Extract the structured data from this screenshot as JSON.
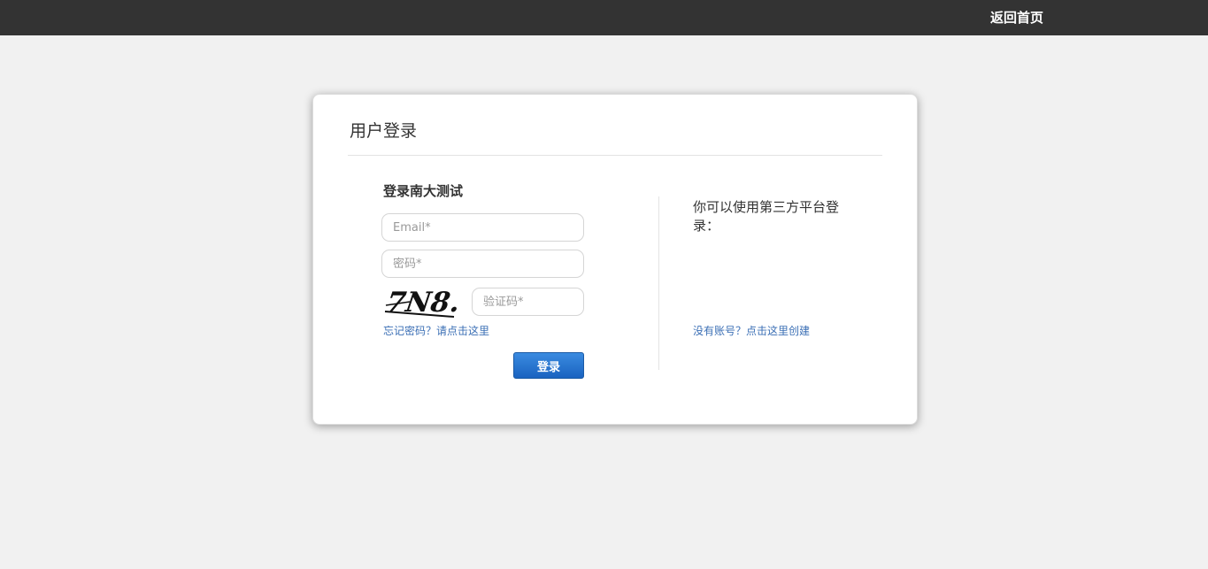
{
  "header": {
    "home_link": "返回首页"
  },
  "login_card": {
    "title": "用户登录",
    "section_title": "登录南大测试",
    "email_placeholder": "Email*",
    "password_placeholder": "密码*",
    "captcha_text": "7N8.",
    "captcha_placeholder": "验证码*",
    "forgot_link": "忘记密码？请点击这里",
    "login_button": "登录",
    "third_party_text": "你可以使用第三方平台登录：",
    "register_link": "没有账号？点击这里创建"
  },
  "colors": {
    "topbar": "#333333",
    "background": "#f1f1f1",
    "link": "#3b6fb5",
    "button": "#1a63c0"
  }
}
